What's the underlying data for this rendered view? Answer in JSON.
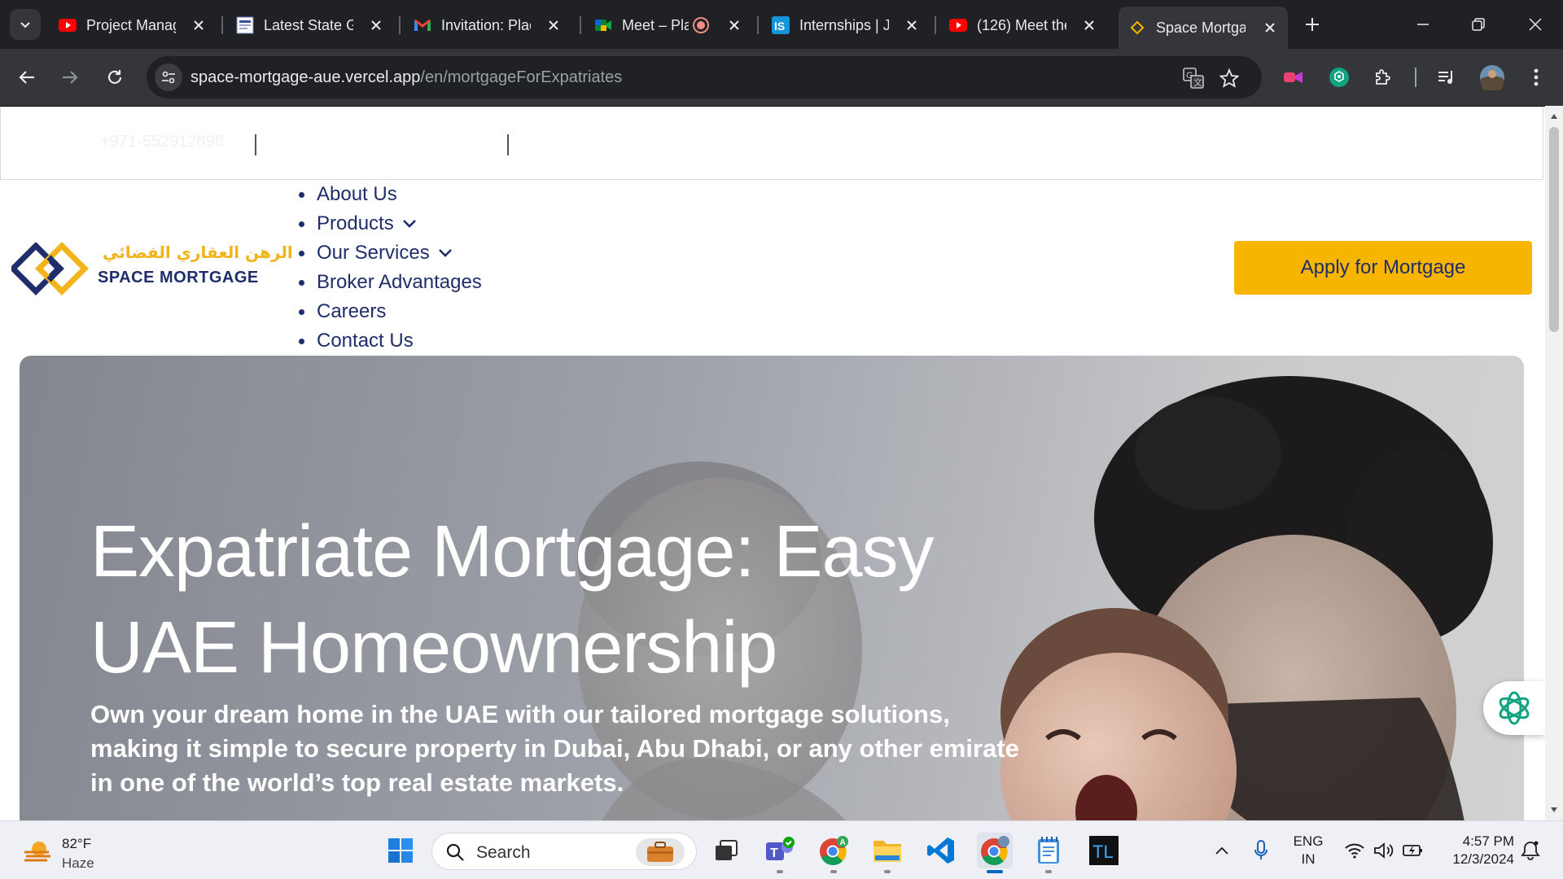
{
  "browser": {
    "tabs": [
      {
        "title": "Project Manag",
        "favicon": "youtube-icon"
      },
      {
        "title": "Latest State G",
        "favicon": "news-icon"
      },
      {
        "title": "Invitation: Plac",
        "favicon": "gmail-icon"
      },
      {
        "title": "Meet – Pla",
        "favicon": "meet-icon",
        "recording": true
      },
      {
        "title": "Internships | Jo",
        "favicon": "internshala-icon"
      },
      {
        "title": "(126) Meet the",
        "favicon": "youtube-icon"
      },
      {
        "title": "Space Mortga",
        "favicon": "space-mortgage-icon",
        "active": true
      }
    ],
    "url_host": "space-mortgage-aue.vercel.app",
    "url_path": "/en/mortgageForExpatriates"
  },
  "page": {
    "topbar": {
      "phone": "+971-552912898"
    },
    "logo": {
      "arabic": "الرهن العقاري الفضائي",
      "english": "SPACE MORTGAGE"
    },
    "nav": [
      {
        "label": "About Us",
        "has_dropdown": false
      },
      {
        "label": "Products",
        "has_dropdown": true
      },
      {
        "label": "Our Services",
        "has_dropdown": true
      },
      {
        "label": "Broker Advantages",
        "has_dropdown": false
      },
      {
        "label": "Careers",
        "has_dropdown": false
      },
      {
        "label": "Contact Us",
        "has_dropdown": false
      }
    ],
    "apply_button": "Apply for Mortgage",
    "hero": {
      "title": "Expatriate Mortgage: Easy UAE Homeownership",
      "subtitle": "Own your dream home in the UAE with our tailored mortgage solutions, making it simple to secure property in Dubai, Abu Dhabi, or any other emirate in one of the world’s top real estate markets."
    }
  },
  "taskbar": {
    "weather": {
      "temp": "82°F",
      "condition": "Haze"
    },
    "search_label": "Search",
    "language": {
      "line1": "ENG",
      "line2": "IN"
    },
    "clock": {
      "time": "4:57 PM",
      "date": "12/3/2024"
    }
  },
  "colors": {
    "brand_navy": "#1f2d6b",
    "brand_yellow": "#f7b500",
    "chrome_dark": "#202124",
    "chrome_toolbar": "#35363a"
  }
}
